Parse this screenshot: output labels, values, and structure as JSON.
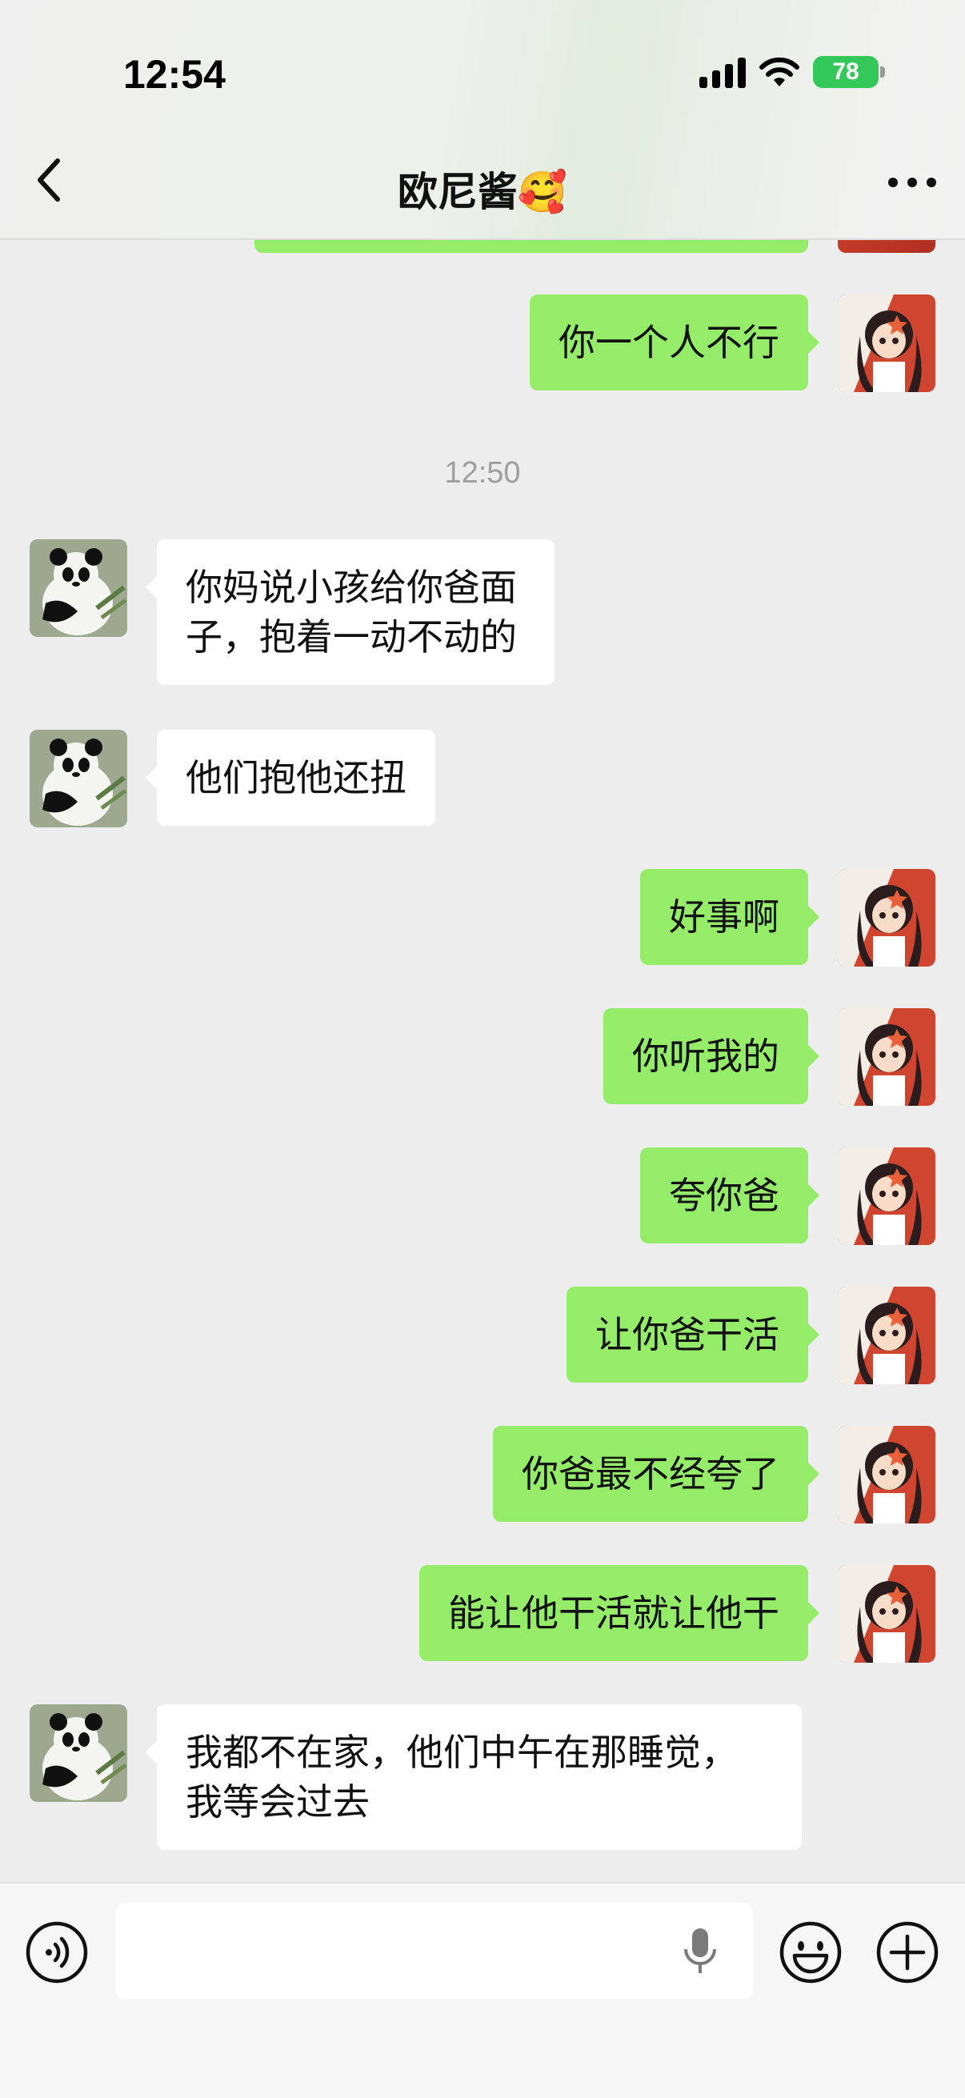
{
  "status_bar": {
    "time": "12:54",
    "battery": "78"
  },
  "header": {
    "title": "欧尼酱🥰"
  },
  "chat": {
    "messages": [
      {
        "side": "right",
        "text": "你一个人不行"
      },
      {
        "type": "timestamp",
        "text": "12:50"
      },
      {
        "side": "left",
        "text": "你妈说小孩给你爸面子，抱着一动不动的"
      },
      {
        "side": "left",
        "text": "他们抱他还扭"
      },
      {
        "side": "right",
        "text": "好事啊"
      },
      {
        "side": "right",
        "text": "你听我的"
      },
      {
        "side": "right",
        "text": "夸你爸"
      },
      {
        "side": "right",
        "text": "让你爸干活"
      },
      {
        "side": "right",
        "text": "你爸最不经夸了"
      },
      {
        "side": "right",
        "text": "能让他干活就让他干"
      },
      {
        "side": "left",
        "text": "我都不在家，他们中午在那睡觉，我等会过去"
      }
    ]
  },
  "colors": {
    "sent_bubble": "#95ec69",
    "received_bubble": "#ffffff",
    "background": "#ededed",
    "battery": "#34c759"
  },
  "icons": {
    "back": "chevron-left-icon",
    "more": "more-dots-icon",
    "voice": "voice-mode-icon",
    "mic": "microphone-icon",
    "emoji": "smiley-icon",
    "plus": "plus-circle-icon"
  }
}
